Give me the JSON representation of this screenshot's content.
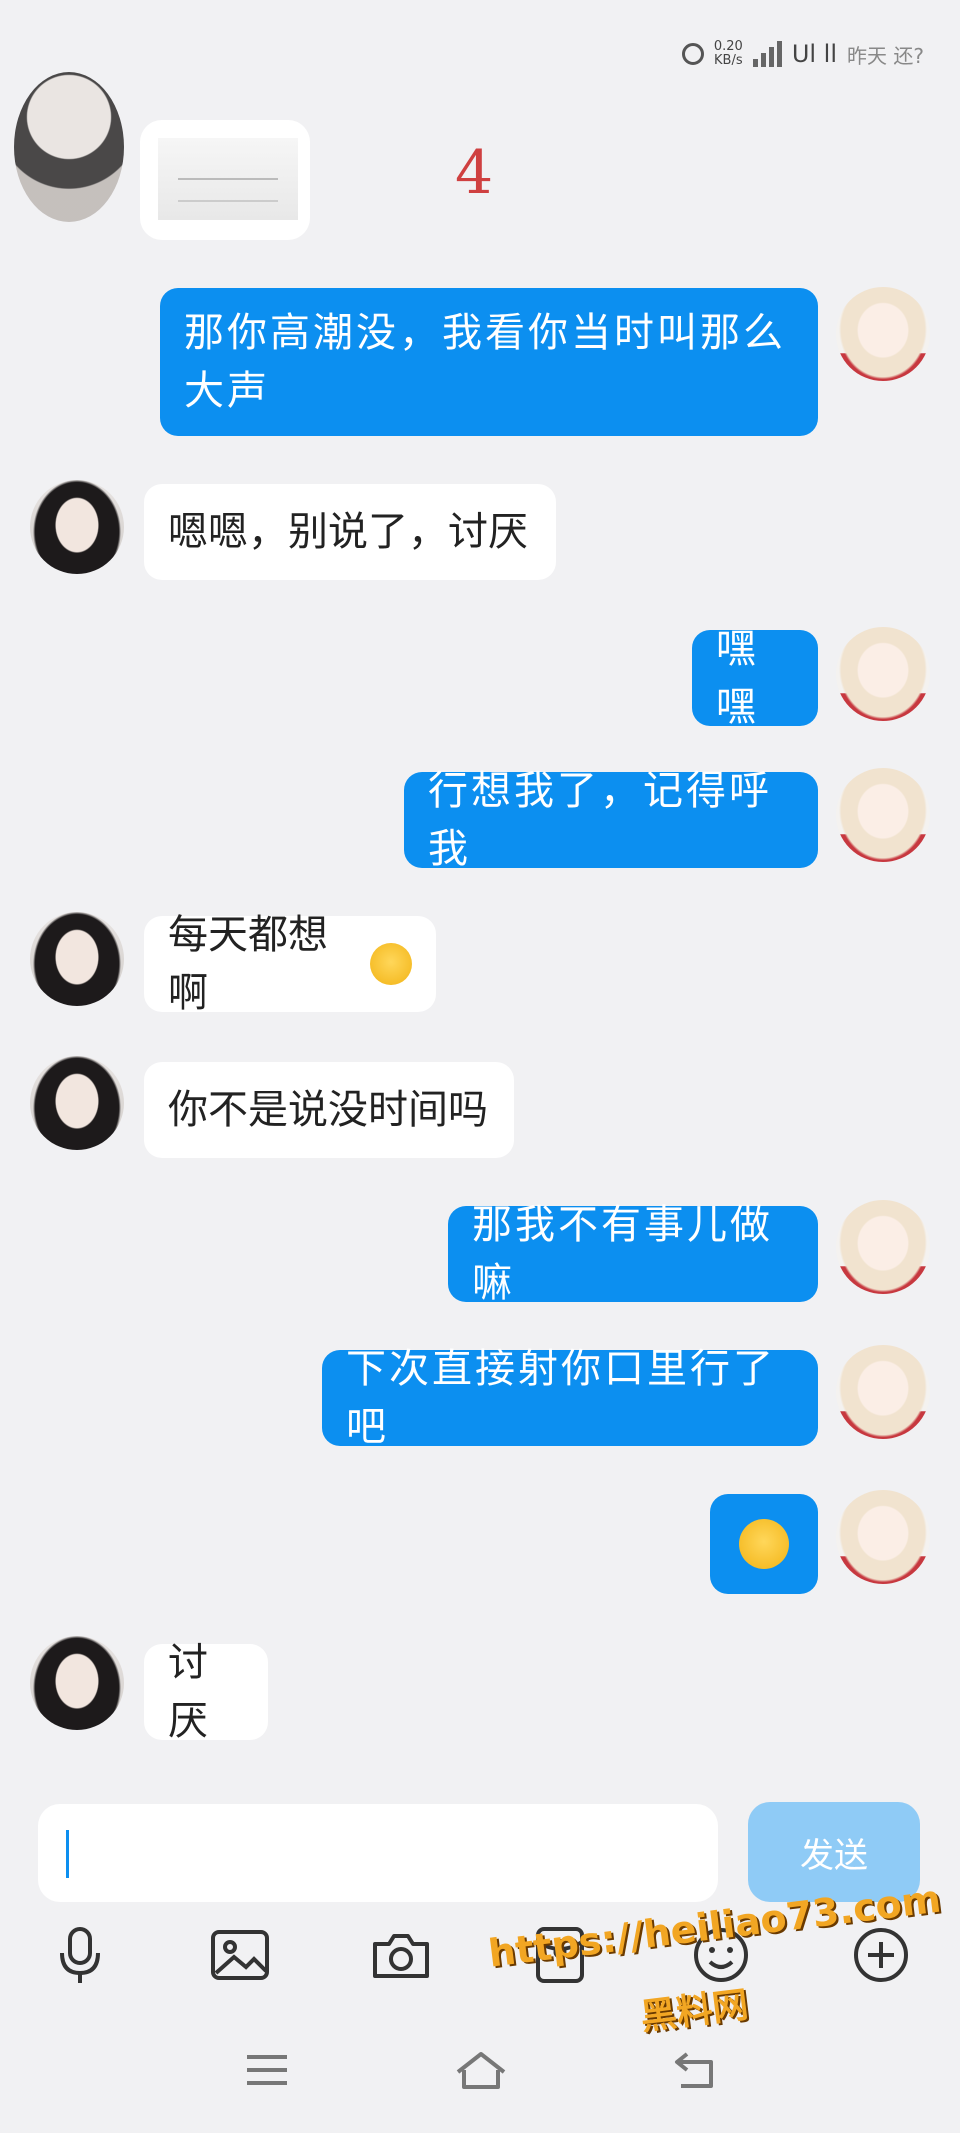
{
  "status_bar": {
    "network_speed_top": "0.20",
    "network_speed_unit": "KB/s",
    "signal_text": "Ul ll",
    "tail_text": "昨天 还?"
  },
  "page_number": "4",
  "messages": [
    {
      "side": "right",
      "text": "那你高潮没，我看你当时叫那么大声"
    },
    {
      "side": "left",
      "text": "嗯嗯，别说了，讨厌"
    },
    {
      "side": "right",
      "text": "嘿嘿"
    },
    {
      "side": "right",
      "text": "行想我了，记得呼我"
    },
    {
      "side": "left",
      "text": "每天都想啊"
    },
    {
      "side": "left",
      "text": "你不是说没时间吗"
    },
    {
      "side": "right",
      "text": "那我不有事儿做嘛"
    },
    {
      "side": "right",
      "text": "下次直接射你口里行了吧"
    },
    {
      "side": "right",
      "text": "",
      "emoji": "blushing-face"
    },
    {
      "side": "left",
      "text": "讨厌"
    }
  ],
  "input": {
    "value": "",
    "placeholder": "",
    "send_label": "发送"
  },
  "toolbar": {
    "icons": [
      "microphone-icon",
      "image-icon",
      "camera-icon",
      "red-packet-icon",
      "emoji-icon",
      "plus-icon"
    ]
  },
  "nav": {
    "icons": [
      "menu-icon",
      "home-icon",
      "back-icon"
    ]
  },
  "watermark": {
    "url": "https://heiliao73.com",
    "site_name": "黑料网"
  },
  "colors": {
    "bubble_right": "#0c8ff0",
    "bubble_left": "#ffffff",
    "background": "#f1f1f3",
    "send_button": "#8fcbf6",
    "watermark": "#f2a623"
  }
}
